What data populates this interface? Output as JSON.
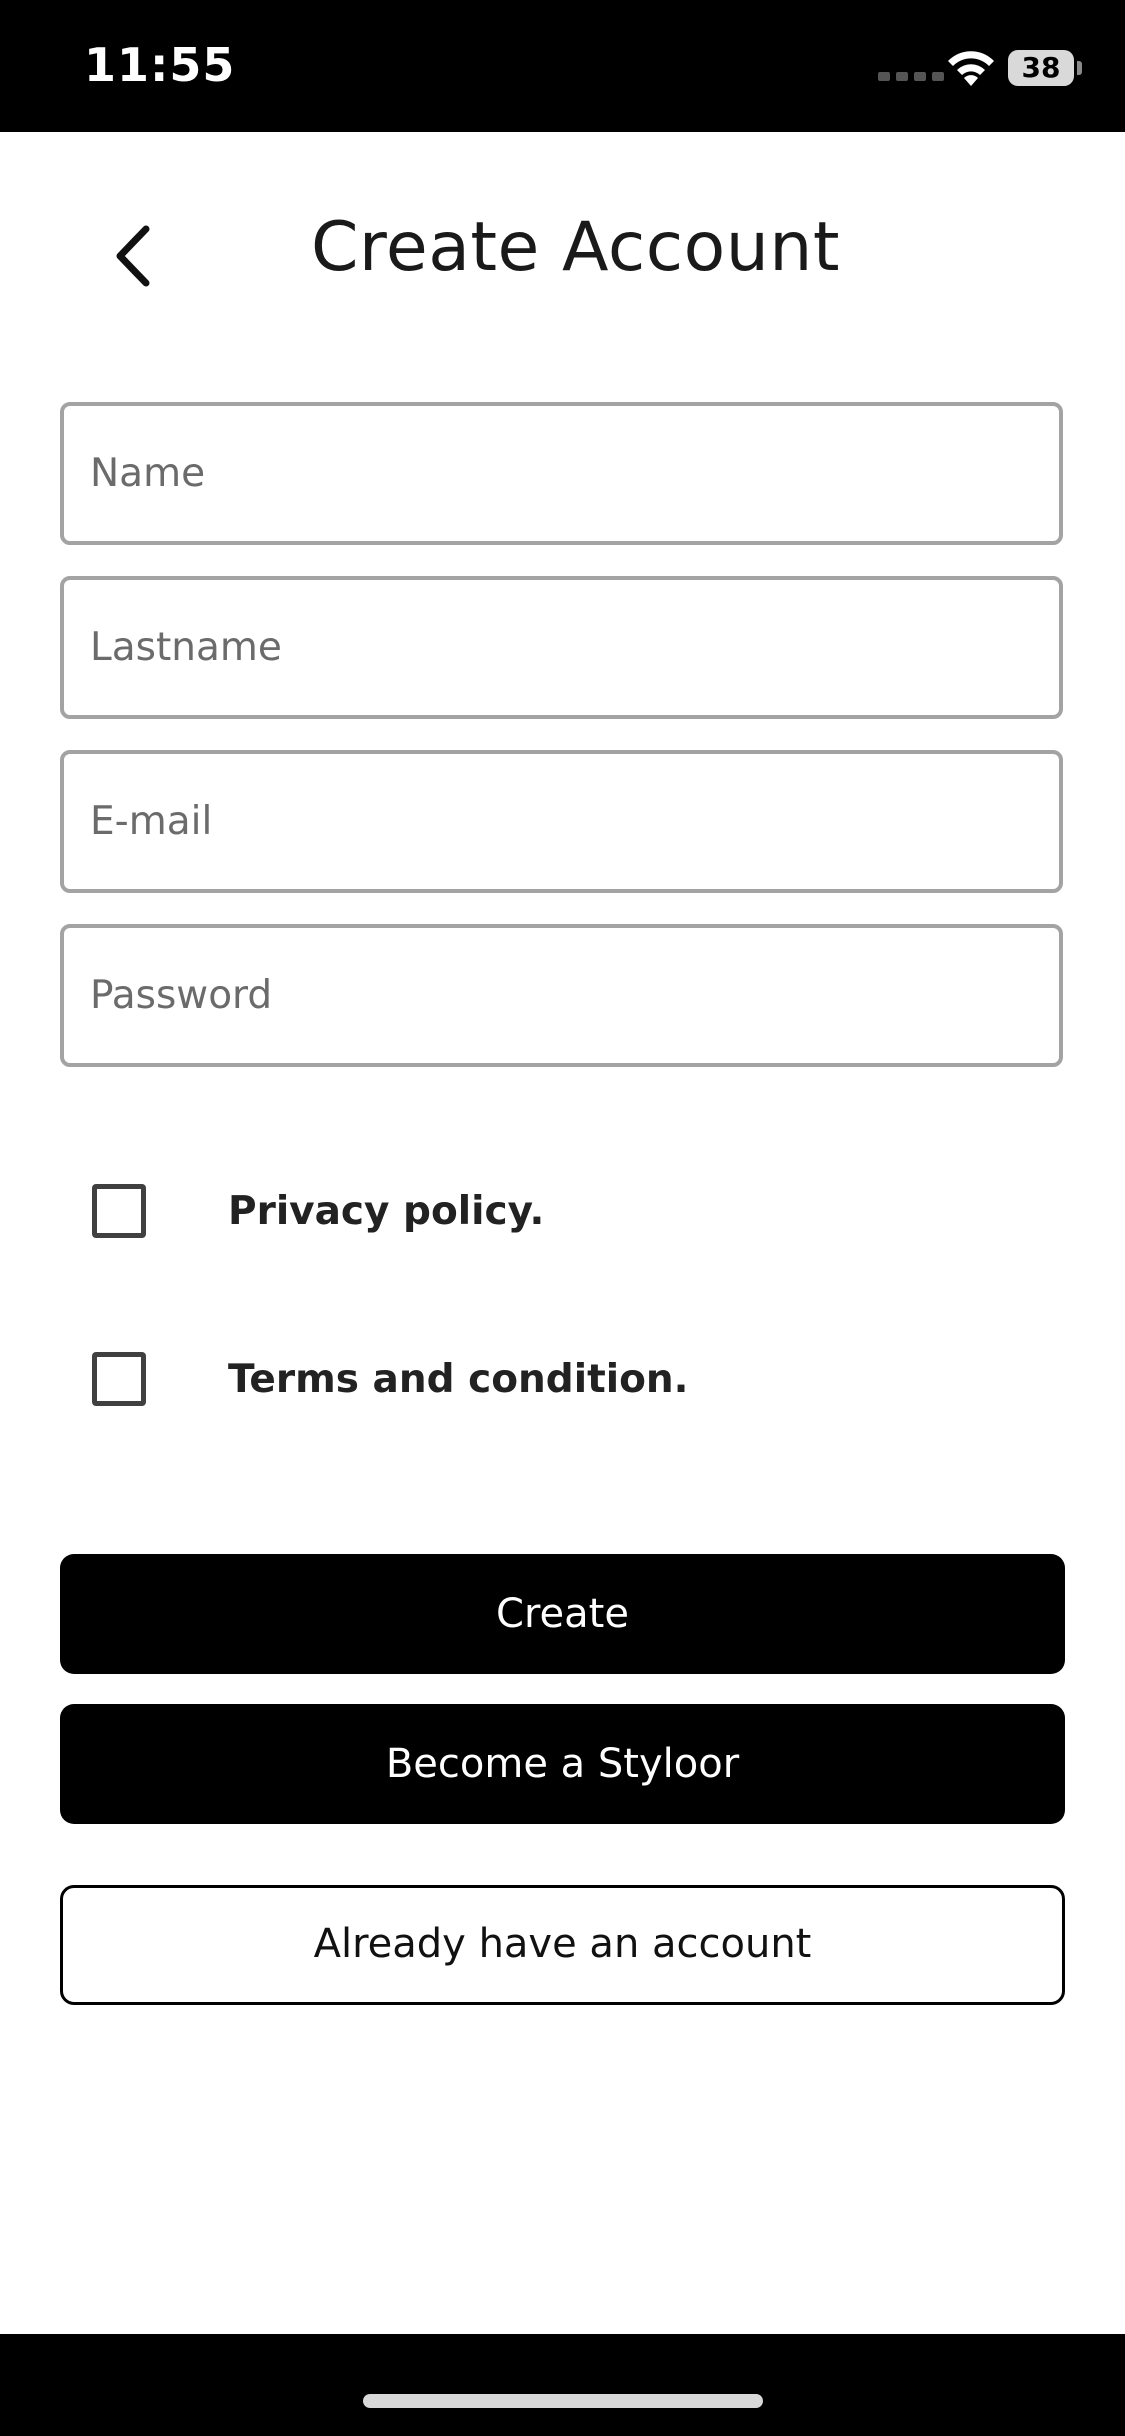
{
  "status_bar": {
    "time": "11:55",
    "battery": "38"
  },
  "header": {
    "title": "Create Account"
  },
  "form": {
    "fields": [
      {
        "placeholder": "Name",
        "value": ""
      },
      {
        "placeholder": "Lastname",
        "value": ""
      },
      {
        "placeholder": "E-mail",
        "value": ""
      },
      {
        "placeholder": "Password",
        "value": ""
      }
    ],
    "checkboxes": [
      {
        "label": "Privacy policy.",
        "checked": false
      },
      {
        "label": "Terms and condition.",
        "checked": false
      }
    ]
  },
  "actions": {
    "create_label": "Create",
    "become_label": "Become a Styloor",
    "login_label": "Already have an account"
  },
  "colors": {
    "primary": "#000000",
    "field_border": "#a3a3a3",
    "background": "#ffffff"
  },
  "icons": {
    "back": "chevron-left-icon",
    "wifi": "wifi-icon",
    "battery": "battery-icon",
    "signal": "cellular-signal-icon"
  }
}
